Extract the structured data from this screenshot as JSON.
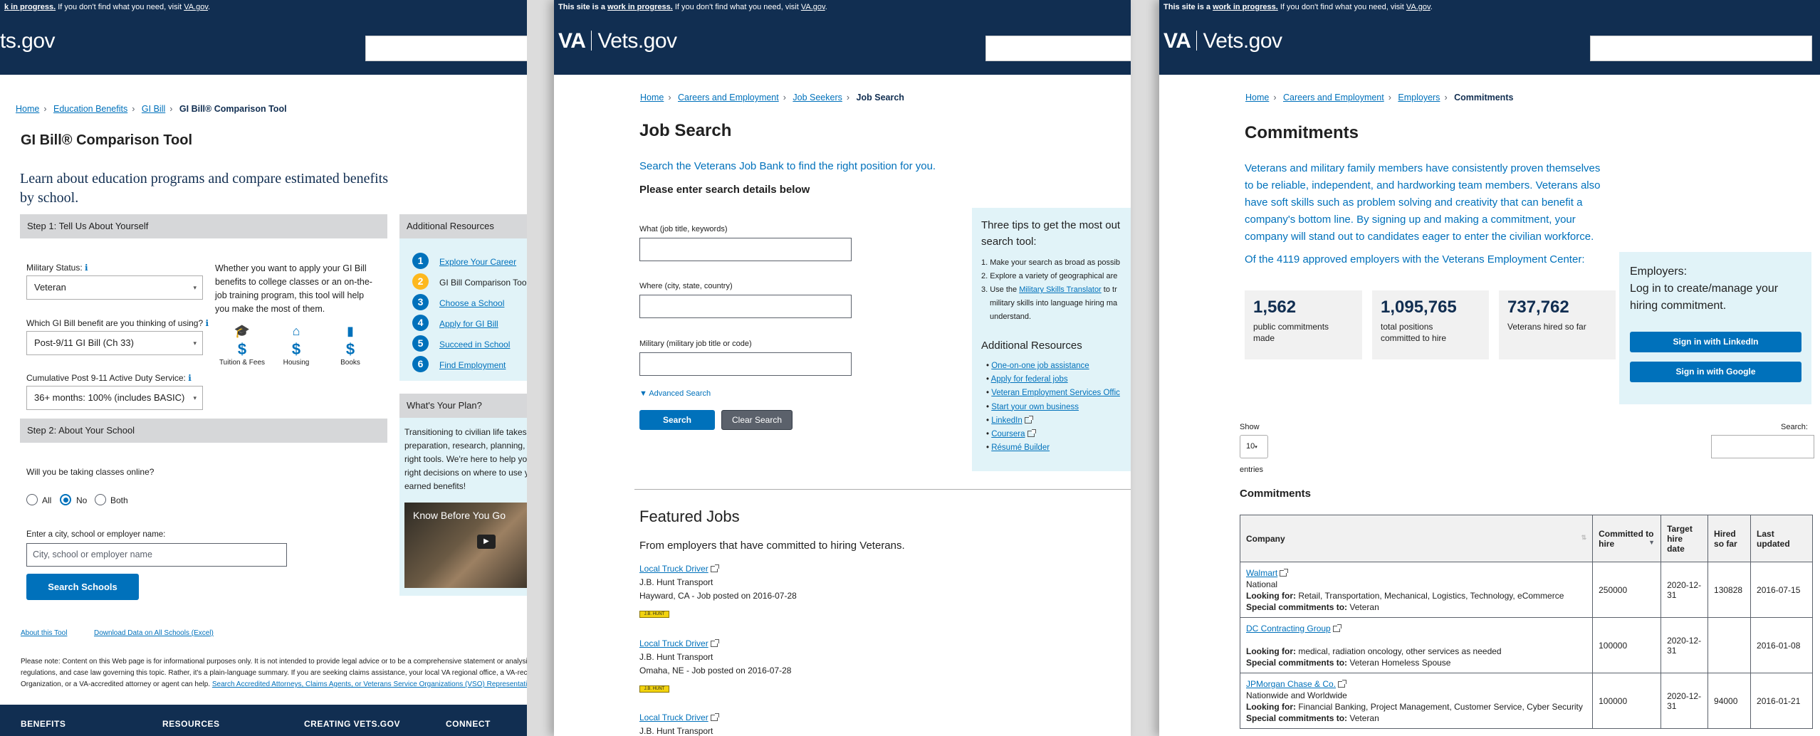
{
  "common": {
    "banner_prefix": "This site is a ",
    "banner_wip": "work in progress.",
    "banner_mid": " If you don't find what you need, visit ",
    "banner_link": "VA.gov",
    "banner_end": ".",
    "logo_va": "VA",
    "logo_site": "Vets.gov"
  },
  "p1": {
    "banner_cut": "k in progress.",
    "logo_cut": "ts.gov",
    "breadcrumb": [
      "Home",
      "Education Benefits",
      "GI Bill",
      "GI Bill® Comparison Tool"
    ],
    "title": "GI Bill® Comparison Tool",
    "intro": "Learn about education programs and compare estimated benefits by school.",
    "step1": "Step 1: Tell Us About Yourself",
    "military_status_label": "Military Status:",
    "military_status_value": "Veteran",
    "benefit_label": "Which GI Bill benefit are you thinking of using?",
    "benefit_value": "Post-9/11 GI Bill (Ch 33)",
    "service_label": "Cumulative Post 9-11 Active Duty Service:",
    "service_value": "36+ months: 100% (includes BASIC)",
    "help_text": "Whether you want to apply your GI Bill benefits to college classes or an on-the-job training program, this tool will help you make the most of them.",
    "icons": [
      {
        "icon": "graduation-cap-icon",
        "label": "Tuition & Fees"
      },
      {
        "icon": "home-icon",
        "label": "Housing"
      },
      {
        "icon": "book-icon",
        "label": "Books"
      }
    ],
    "step2": "Step 2: About Your School",
    "online_question": "Will you be taking classes online?",
    "radio_all": "All",
    "radio_no": "No",
    "radio_both": "Both",
    "search_label": "Enter a city, school or employer name:",
    "search_placeholder": "City, school or employer name",
    "search_button": "Search Schools",
    "about_link": "About this Tool",
    "download_link": "Download Data on All Schools (Excel)",
    "resources_title": "Additional Resources",
    "resources": [
      {
        "n": "1",
        "label": "Explore Your Career"
      },
      {
        "n": "2",
        "label": "GI Bill Comparison Tool"
      },
      {
        "n": "3",
        "label": "Choose a School"
      },
      {
        "n": "4",
        "label": "Apply for GI Bill"
      },
      {
        "n": "5",
        "label": "Succeed in School"
      },
      {
        "n": "6",
        "label": "Find Employment"
      }
    ],
    "plan_title": "What's Your Plan?",
    "plan_text": [
      "Transitioning to civilian life takes",
      "preparation, research, planning,",
      "right tools. We're here to help you",
      "right decisions on where to use y",
      "earned benefits!"
    ],
    "video_title": "Know Before You Go",
    "disclaimer_1": "Please note: Content on this Web page is for informational purposes only. It is not intended to provide legal advice or to be a comprehensive statement or analysis of ap",
    "disclaimer_2": "regulations, and case law governing this topic. Rather, it's a plain-language summary. If you are seeking claims assistance, your local VA regional office, a VA-recognized",
    "disclaimer_3": "Organization, or a VA-accredited attorney or agent can help.",
    "disclaimer_link": "Search Accredited Attorneys, Claims Agents, or Veterans Service Organizations (VSO) Representatives",
    "footer": [
      "BENEFITS",
      "RESOURCES",
      "CREATING VETS.GOV",
      "CONNECT"
    ]
  },
  "p2": {
    "breadcrumb": [
      "Home",
      "Careers and Employment",
      "Job Seekers",
      "Job Search"
    ],
    "title": "Job Search",
    "intro": "Search the Veterans Job Bank to find the right position for you.",
    "subtitle": "Please enter search details below",
    "what_label": "What (job title, keywords)",
    "where_label": "Where (city, state, country)",
    "military_label": "Military (military job title or code)",
    "advanced": "▼ Advanced Search",
    "search_btn": "Search",
    "clear_btn": "Clear Search",
    "tips_title_1": "Three tips to get the most out",
    "tips_title_2": "search tool:",
    "tips": [
      "1. Make your search as broad as possib",
      "2. Explore a variety of geographical are",
      "3. Use the "
    ],
    "tip3_link": "Military Skills Translator",
    "tip3_rest": " to tr",
    "tip3_line2": "military skills into language hiring ma",
    "tip3_line3": "understand.",
    "resources_title": "Additional Resources",
    "resources": [
      "One-on-one job assistance",
      "Apply for federal jobs",
      "Veteran Employment Services Offic",
      "Start your own business",
      "LinkedIn",
      "Coursera",
      "Résumé Builder"
    ],
    "featured_title": "Featured Jobs",
    "featured_sub": "From employers that have committed to hiring Veterans.",
    "jobs": [
      {
        "title": "Local Truck Driver",
        "company": "J.B. Hunt Transport",
        "posted": "Hayward, CA - Job posted on 2016-07-28",
        "badge": "J.B. HUNT"
      },
      {
        "title": "Local Truck Driver",
        "company": "J.B. Hunt Transport",
        "posted": "Omaha, NE - Job posted on 2016-07-28",
        "badge": "J.B. HUNT"
      },
      {
        "title": "Local Truck Driver",
        "company": "J.B. Hunt Transport",
        "posted": "",
        "badge": ""
      }
    ]
  },
  "p3": {
    "breadcrumb": [
      "Home",
      "Careers and Employment",
      "Employers",
      "Commitments"
    ],
    "title": "Commitments",
    "intro_lines": [
      "Veterans and military family members have consistently proven themselves",
      "to be reliable, independent, and hardworking team members. Veterans also",
      "have soft skills such as problem solving and creativity that can benefit a",
      "company's bottom line. By signing up and making a commitment, your",
      "company will stand out to candidates eager to enter the civilian workforce."
    ],
    "approved": "Of the 4119 approved employers with the Veterans Employment Center:",
    "stats": [
      {
        "n": "1,562",
        "d": "public commitments made"
      },
      {
        "n": "1,095,765",
        "d": "total positions committed to hire"
      },
      {
        "n": "737,762",
        "d": "Veterans hired so far"
      }
    ],
    "employers_title": "Employers:",
    "employers_text": "Log in to create/manage your hiring commitment.",
    "linkedin_btn": "Sign in with LinkedIn",
    "google_btn": "Sign in with Google",
    "show_label": "Show",
    "show_value": "10",
    "entries_label": "entries",
    "search_label": "Search:",
    "table_title": "Commitments",
    "headers": [
      "Company",
      "Committed to hire",
      "Target hire date",
      "Hired so far",
      "Last updated"
    ],
    "rows": [
      {
        "company": "Walmart",
        "region": "National",
        "looking": "Retail, Transportation, Mechanical, Logistics, Technology, eCommerce",
        "special": "Veteran",
        "committed": "250000",
        "target": "2020-12-31",
        "hired": "130828",
        "updated": "2016-07-15"
      },
      {
        "company": "DC Contracting Group",
        "region": "",
        "looking": "medical, radiation oncology, other services as needed",
        "special": "Veteran Homeless Spouse",
        "committed": "100000",
        "target": "2020-12-31",
        "hired": "",
        "updated": "2016-01-08"
      },
      {
        "company": "JPMorgan Chase & Co.",
        "region": "Nationwide and Worldwide",
        "looking": "Financial Banking, Project Management, Customer Service, Cyber Security",
        "special": "Veteran",
        "committed": "100000",
        "target": "2020-12-31",
        "hired": "94000",
        "updated": "2016-01-21"
      }
    ],
    "looking_label": "Looking for:",
    "special_label": "Special commitments to:"
  }
}
